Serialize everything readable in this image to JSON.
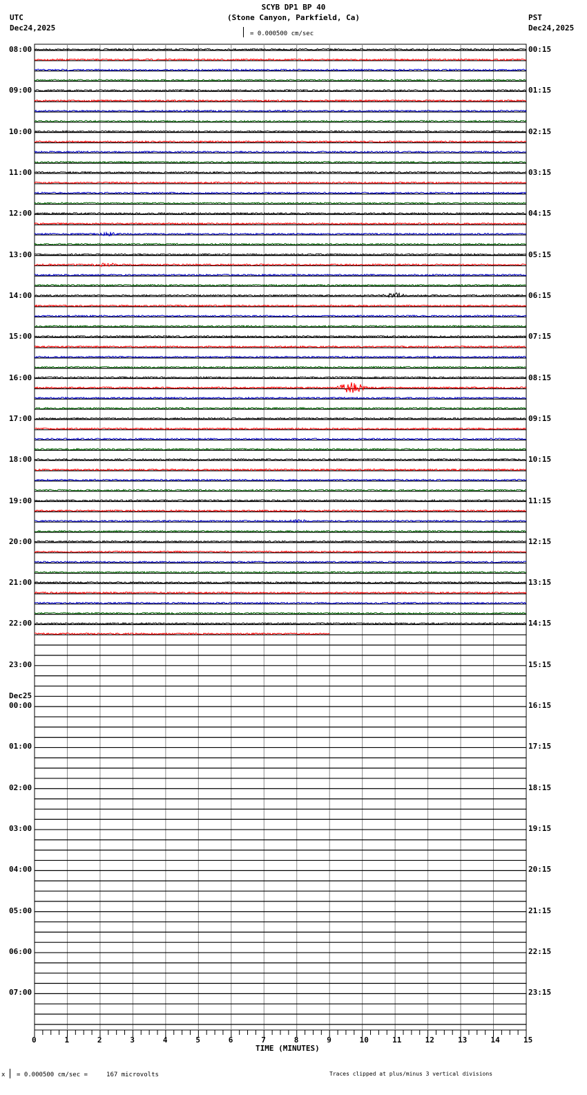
{
  "header": {
    "title": "SCYB DP1 BP 40",
    "subtitle": "(Stone Canyon, Parkfield, Ca)",
    "left_tz": "UTC",
    "left_date": "Dec24,2025",
    "right_tz": "PST",
    "right_date": "Dec24,2025",
    "scale_label": "= 0.000500 cm/sec"
  },
  "footer": {
    "scale_prefix": "x",
    "scale_text": "= 0.000500 cm/sec =     167 microvolts",
    "clip_note": "Traces clipped at plus/minus 3 vertical divisions"
  },
  "chart_data": {
    "type": "line",
    "title": "SCYB DP1 BP 40",
    "xlabel": "TIME (MINUTES)",
    "xlim": [
      0,
      15
    ],
    "x_ticks": [
      "0",
      "1",
      "2",
      "3",
      "4",
      "5",
      "6",
      "7",
      "8",
      "9",
      "10",
      "11",
      "12",
      "13",
      "14",
      "15"
    ],
    "rows_per_hour": 4,
    "row_minutes": 15,
    "total_rows": 96,
    "trace_colors": [
      "#000000",
      "#ff0000",
      "#0000cc",
      "#006600"
    ],
    "left_labels": [
      "08:00",
      "09:00",
      "10:00",
      "11:00",
      "12:00",
      "13:00",
      "14:00",
      "15:00",
      "16:00",
      "17:00",
      "18:00",
      "19:00",
      "20:00",
      "21:00",
      "22:00",
      "23:00",
      "00:00",
      "01:00",
      "02:00",
      "03:00",
      "04:00",
      "05:00",
      "06:00",
      "07:00"
    ],
    "date_change_label": "Dec25",
    "right_labels": [
      "00:15",
      "01:15",
      "02:15",
      "03:15",
      "04:15",
      "05:15",
      "06:15",
      "07:15",
      "08:15",
      "09:15",
      "10:15",
      "11:15",
      "12:15",
      "13:15",
      "14:15",
      "15:15",
      "16:15",
      "17:15",
      "18:15",
      "19:15",
      "20:15",
      "21:15",
      "22:15",
      "23:15"
    ],
    "data_end": {
      "row": 57,
      "minute": 9
    },
    "events": [
      {
        "row": 18,
        "minute": 2.3,
        "amplitude": 2
      },
      {
        "row": 21,
        "minute": 2.1,
        "amplitude": 2
      },
      {
        "row": 24,
        "minute": 11.0,
        "amplitude": 2.5
      },
      {
        "row": 33,
        "minute": 9.7,
        "amplitude": 6
      },
      {
        "row": 46,
        "minute": 8.0,
        "amplitude": 1.5
      }
    ]
  }
}
